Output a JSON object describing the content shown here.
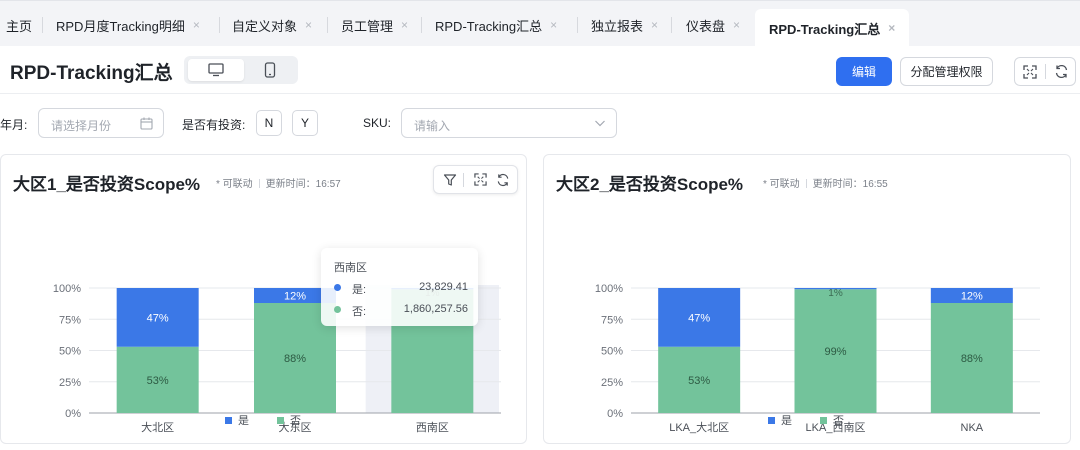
{
  "tabs": [
    {
      "label": "主页",
      "closable": false,
      "active": false
    },
    {
      "label": "RPD月度Tracking明细",
      "closable": true,
      "active": false
    },
    {
      "label": "自定义对象",
      "closable": true,
      "active": false
    },
    {
      "label": "员工管理",
      "closable": true,
      "active": false
    },
    {
      "label": "RPD-Tracking汇总",
      "closable": true,
      "active": false
    },
    {
      "label": "独立报表",
      "closable": true,
      "active": false
    },
    {
      "label": "仪表盘",
      "closable": true,
      "active": false
    },
    {
      "label": "RPD-Tracking汇总",
      "closable": true,
      "active": true
    }
  ],
  "tab_close_glyph": "×",
  "header": {
    "title": "RPD-Tracking汇总",
    "edit_label": "编辑",
    "permission_label": "分配管理权限"
  },
  "filters": {
    "month_label": "年月:",
    "month_placeholder": "请选择月份",
    "invest_label": "是否有投资:",
    "invest_options": [
      "N",
      "Y"
    ],
    "sku_label": "SKU:",
    "sku_placeholder": "请输入"
  },
  "colors": {
    "accent": "#2f6ff0",
    "series_yes": "#3b78e7",
    "series_no": "#73c39b",
    "hover_band": "#eef0f6"
  },
  "icons": {
    "device_desktop": "desktop-icon",
    "device_mobile": "mobile-icon",
    "fullscreen": "fullscreen-icon",
    "refresh": "refresh-icon",
    "filter": "filter-icon",
    "calendar": "calendar-icon",
    "dropdown": "chevron-down-icon"
  },
  "cards": [
    {
      "title": "大区1_是否投资Scope%",
      "linkable": "* 可联动",
      "update_time": "更新时间：16:57"
    },
    {
      "title": "大区2_是否投资Scope%",
      "linkable": "* 可联动",
      "update_time": "更新时间：16:55"
    }
  ],
  "tooltip": {
    "category": "西南区",
    "rows": [
      {
        "name": "是:",
        "value": "23,829.41"
      },
      {
        "name": "否:",
        "value": "1,860,257.56"
      }
    ]
  },
  "chart_data": [
    {
      "type": "bar",
      "stacked": true,
      "percent": true,
      "title": "大区1_是否投资Scope%",
      "categories": [
        "大北区",
        "大东区",
        "西南区"
      ],
      "series": [
        {
          "name": "是",
          "values": [
            47,
            12,
            1
          ],
          "labels": [
            "47%",
            "12%",
            "1%"
          ]
        },
        {
          "name": "否",
          "values": [
            53,
            88,
            99
          ],
          "labels": [
            "53%",
            "88%",
            ""
          ]
        }
      ],
      "y_ticks": [
        "0%",
        "25%",
        "50%",
        "75%",
        "100%"
      ],
      "ylim": [
        0,
        100
      ],
      "legend": "bottom-center",
      "highlighted_category": "西南区",
      "grid": true
    },
    {
      "type": "bar",
      "stacked": true,
      "percent": true,
      "title": "大区2_是否投资Scope%",
      "categories": [
        "LKA_大北区",
        "LKA_西南区",
        "NKA"
      ],
      "series": [
        {
          "name": "是",
          "values": [
            47,
            1,
            12
          ],
          "labels": [
            "47%",
            "1%",
            "12%"
          ]
        },
        {
          "name": "否",
          "values": [
            53,
            99,
            88
          ],
          "labels": [
            "53%",
            "99%",
            "88%"
          ]
        }
      ],
      "y_ticks": [
        "0%",
        "25%",
        "50%",
        "75%",
        "100%"
      ],
      "ylim": [
        0,
        100
      ],
      "legend": "bottom-center",
      "grid": true
    }
  ]
}
